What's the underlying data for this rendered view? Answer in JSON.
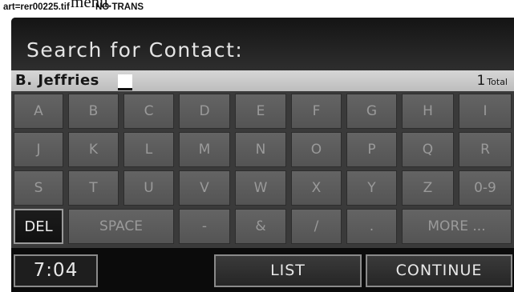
{
  "header": {
    "clipped_text": "menu.",
    "art_label": "art=rer00225.tif",
    "art_note": "NO TRANS"
  },
  "screen": {
    "title": "Search for Contact:",
    "entry": {
      "value": "B. Jeffries",
      "count": "1",
      "count_label": "Total"
    },
    "keyboard": {
      "rows": [
        [
          "A",
          "B",
          "C",
          "D",
          "E",
          "F",
          "G",
          "H",
          "I"
        ],
        [
          "J",
          "K",
          "L",
          "M",
          "N",
          "O",
          "P",
          "Q",
          "R"
        ],
        [
          "S",
          "T",
          "U",
          "V",
          "W",
          "X",
          "Y",
          "Z",
          "0-9"
        ],
        [
          "DEL",
          "SPACE",
          "-",
          "&",
          "/",
          ".",
          "MORE ..."
        ]
      ]
    },
    "footer": {
      "time": "7:04",
      "list": "LIST",
      "continue": "CONTINUE"
    }
  },
  "colors": {
    "active_key_text": "#ececec",
    "inactive_key_text": "#9a9a9a",
    "entry_bar": "#c8c8c8",
    "screen_background": "#4a4a4a"
  }
}
